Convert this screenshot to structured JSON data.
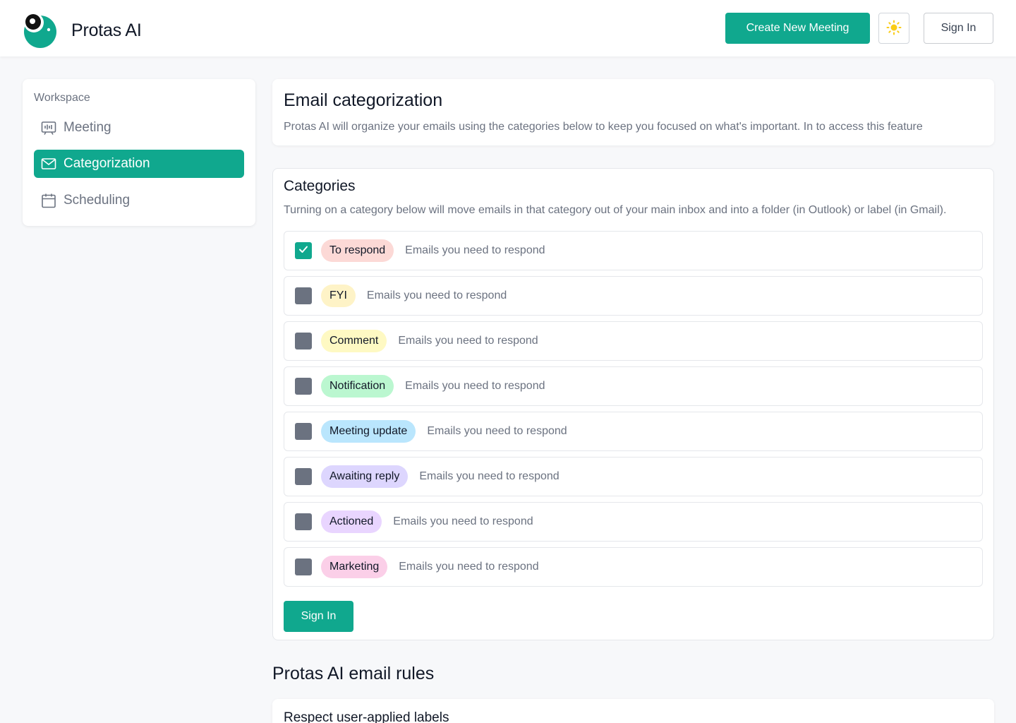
{
  "header": {
    "brand": "Protas AI",
    "create_label": "Create New Meeting",
    "signin_label": "Sign In"
  },
  "sidebar": {
    "heading": "Workspace",
    "items": [
      {
        "label": "Meeting",
        "icon": "meeting-icon",
        "active": false
      },
      {
        "label": "Categorization",
        "icon": "mail-icon",
        "active": true
      },
      {
        "label": "Scheduling",
        "icon": "calendar-icon",
        "active": false
      }
    ]
  },
  "intro": {
    "title": "Email categorization",
    "description": "Protas AI will organize your emails using the categories below to keep you focused on what's important. In  to access this feature"
  },
  "categories": {
    "title": "Categories",
    "description": "Turning on a category below will move emails in that category out of your main inbox and into a folder (in Outlook) or label (in Gmail).",
    "items": [
      {
        "label": "To respond",
        "description": "Emails you need to respond",
        "checked": true,
        "color": "#fcd9d6"
      },
      {
        "label": "FYI",
        "description": "Emails you need to respond",
        "checked": false,
        "color": "#fef3c7"
      },
      {
        "label": "Comment",
        "description": "Emails you need to respond",
        "checked": false,
        "color": "#fef9c3"
      },
      {
        "label": "Notification",
        "description": "Emails you need to respond",
        "checked": false,
        "color": "#bbf7d0"
      },
      {
        "label": "Meeting update",
        "description": "Emails you need to respond",
        "checked": false,
        "color": "#bae6fd"
      },
      {
        "label": "Awaiting reply",
        "description": "Emails you need to respond",
        "checked": false,
        "color": "#ddd6fe"
      },
      {
        "label": "Actioned",
        "description": "Emails you need to respond",
        "checked": false,
        "color": "#e9d5ff"
      },
      {
        "label": "Marketing",
        "description": "Emails you need to respond",
        "checked": false,
        "color": "#fbcfe8"
      }
    ],
    "signin_label": "Sign In"
  },
  "rules": {
    "title": "Protas AI email rules",
    "first_rule": "Respect user-applied labels"
  },
  "colors": {
    "accent": "#10a88e",
    "unchecked": "#6b7280",
    "sun": "#facc15"
  }
}
